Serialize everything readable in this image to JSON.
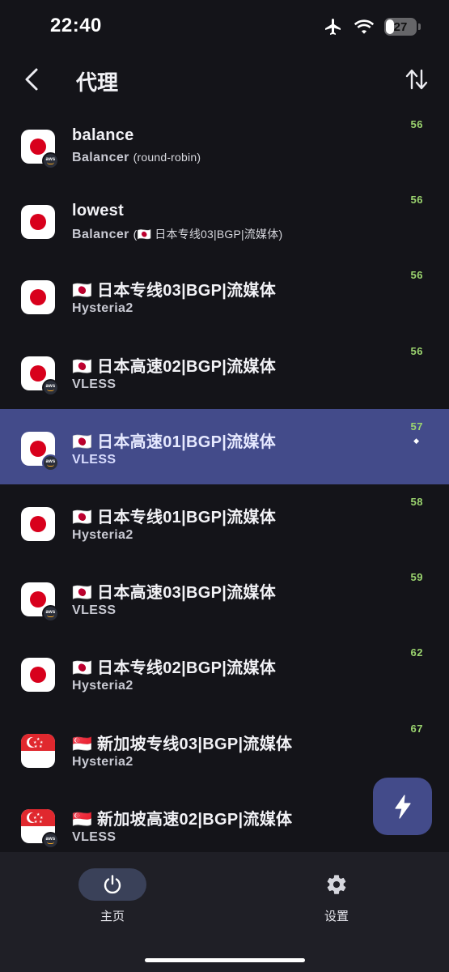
{
  "status_bar": {
    "time": "22:40",
    "battery": "27"
  },
  "header": {
    "title": "代理"
  },
  "proxies": [
    {
      "flag": "jp",
      "aws": true,
      "name": "balance",
      "type": "Balancer",
      "detail": "(round-robin)",
      "latency": "56",
      "selected": false
    },
    {
      "flag": "jp",
      "aws": false,
      "name": "lowest",
      "type": "Balancer",
      "detail": "(🇯🇵 日本专线03|BGP|流媒体)",
      "latency": "56",
      "selected": false
    },
    {
      "flag": "jp",
      "aws": false,
      "name": "🇯🇵 日本专线03|BGP|流媒体",
      "type": "Hysteria2",
      "detail": "",
      "latency": "56",
      "selected": false
    },
    {
      "flag": "jp",
      "aws": true,
      "name": "🇯🇵 日本高速02|BGP|流媒体",
      "type": "VLESS",
      "detail": "",
      "latency": "56",
      "selected": false
    },
    {
      "flag": "jp",
      "aws": true,
      "name": "🇯🇵 日本高速01|BGP|流媒体",
      "type": "VLESS",
      "detail": "",
      "latency": "57",
      "selected": true
    },
    {
      "flag": "jp",
      "aws": false,
      "name": "🇯🇵 日本专线01|BGP|流媒体",
      "type": "Hysteria2",
      "detail": "",
      "latency": "58",
      "selected": false
    },
    {
      "flag": "jp",
      "aws": true,
      "name": "🇯🇵 日本高速03|BGP|流媒体",
      "type": "VLESS",
      "detail": "",
      "latency": "59",
      "selected": false
    },
    {
      "flag": "jp",
      "aws": false,
      "name": "🇯🇵 日本专线02|BGP|流媒体",
      "type": "Hysteria2",
      "detail": "",
      "latency": "62",
      "selected": false
    },
    {
      "flag": "sg",
      "aws": false,
      "name": "🇸🇬 新加坡专线03|BGP|流媒体",
      "type": "Hysteria2",
      "detail": "",
      "latency": "67",
      "selected": false
    },
    {
      "flag": "sg",
      "aws": true,
      "name": "🇸🇬 新加坡高速02|BGP|流媒体",
      "type": "VLESS",
      "detail": "",
      "latency": "",
      "selected": false
    }
  ],
  "fab": {
    "icon": "lightning-icon"
  },
  "nav": {
    "home_label": "主页",
    "settings_label": "设置"
  },
  "colors": {
    "background": "#141419",
    "selected_row": "#434b8a",
    "latency": "#9bd46f",
    "nav_bar": "#1f1f26"
  }
}
